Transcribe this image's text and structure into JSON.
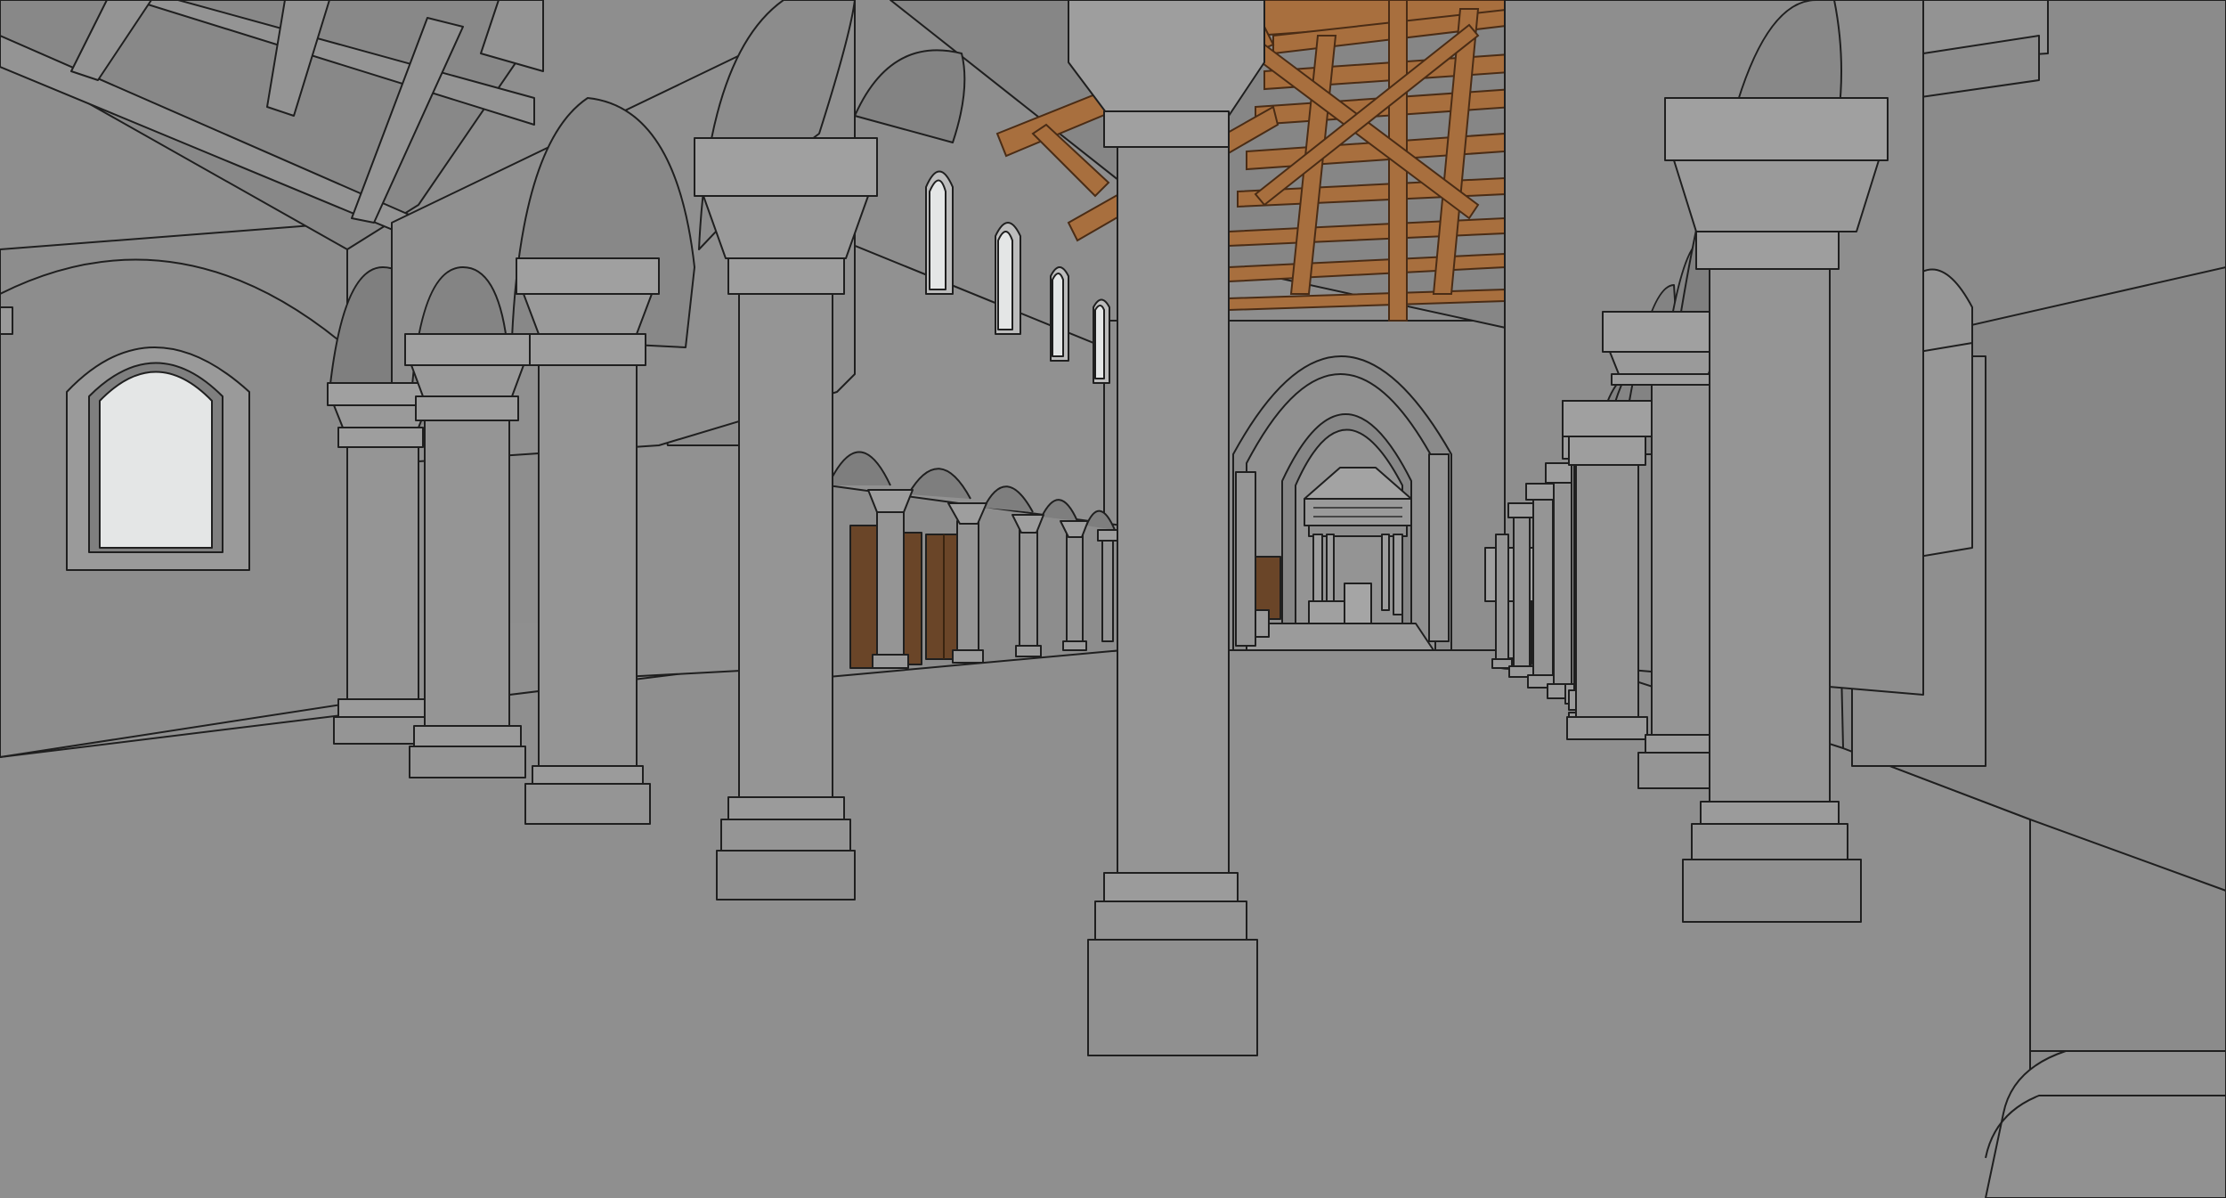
{
  "scene": {
    "colors": {
      "wall": "#8c8c8c",
      "wall_light": "#9a9a9a",
      "wall_dark": "#7d7d7d",
      "floor": "#8f8f8f",
      "ceiling": "#868686",
      "column": "#959595",
      "column_shade": "#838383",
      "window": "#e4e6e6",
      "wood": "#a86f3e",
      "wood_dark": "#6f4324",
      "door": "#6a4528",
      "outline": "#1f1f1f"
    }
  }
}
